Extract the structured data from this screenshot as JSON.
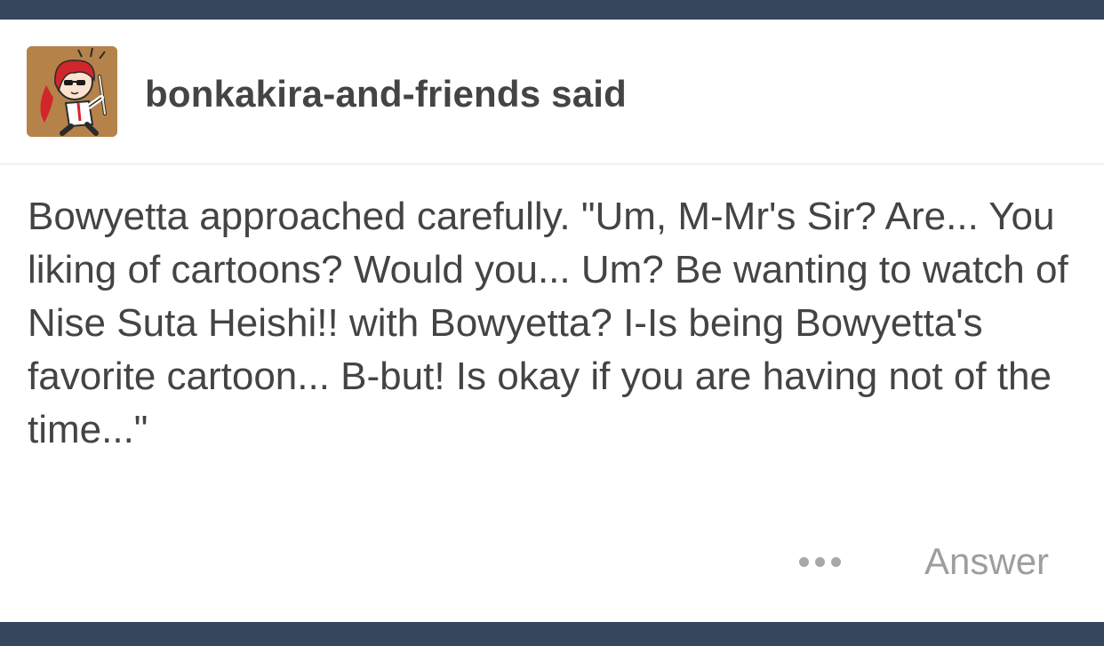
{
  "ask": {
    "asker_label": "bonkakira-and-friends said",
    "question_text": "Bowyetta approached carefully. \"Um, M-Mr's Sir? Are... You liking of cartoons? Would you... Um? Be wanting to watch of Nise Suta Heishi!! with Bowyetta? I-Is being Bowyetta's favorite cartoon... B-but! Is okay if you are having not of the time...\""
  },
  "actions": {
    "more_icon": "ellipsis-icon",
    "answer_label": "Answer"
  },
  "colors": {
    "nav_bar": "#36465d",
    "card_background": "#ffffff",
    "text": "#444444",
    "muted": "#9e9e9e"
  }
}
